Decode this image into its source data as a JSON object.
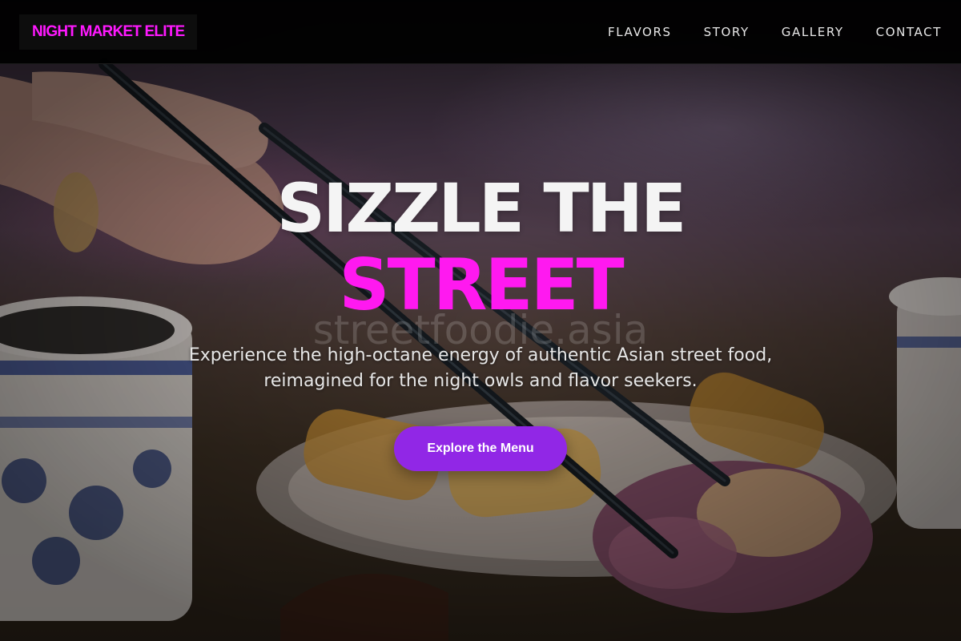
{
  "brand": {
    "name": "NIGHT MARKET ELITE"
  },
  "nav": {
    "items": [
      {
        "label": "FLAVORS"
      },
      {
        "label": "STORY"
      },
      {
        "label": "GALLERY"
      },
      {
        "label": "CONTACT"
      }
    ]
  },
  "hero": {
    "title_line1": "SIZZLE THE",
    "title_line2": "STREET",
    "watermark": "streetfoodie.asia",
    "subtitle": "Experience the high-octane energy of authentic Asian street food, reimagined for the night owls and flavor seekers.",
    "cta_label": "Explore the Menu"
  },
  "colors": {
    "accent_magenta": "#ff19f0",
    "button_purple": "#9127e6",
    "navbar_bg": "#000000",
    "text_light": "#f4f4f4"
  }
}
